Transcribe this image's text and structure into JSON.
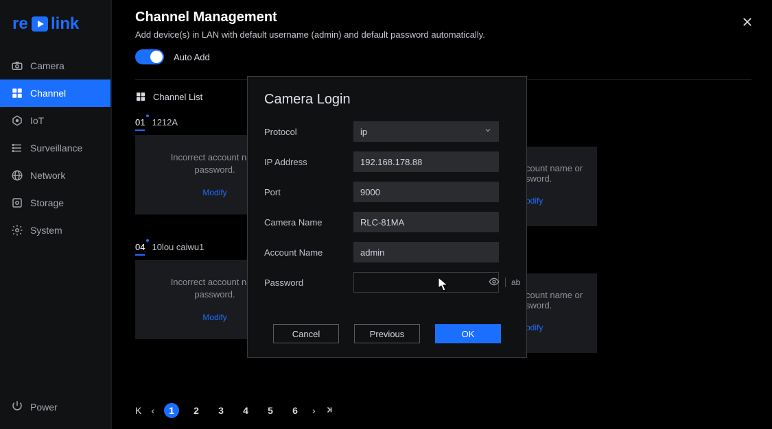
{
  "brand": {
    "name": "reolink"
  },
  "sidebar": {
    "items": [
      {
        "label": "Camera",
        "icon": "camera-icon"
      },
      {
        "label": "Channel",
        "icon": "channel-icon"
      },
      {
        "label": "IoT",
        "icon": "iot-icon"
      },
      {
        "label": "Surveillance",
        "icon": "surveillance-icon"
      },
      {
        "label": "Network",
        "icon": "network-icon"
      },
      {
        "label": "Storage",
        "icon": "storage-icon"
      },
      {
        "label": "System",
        "icon": "system-icon"
      }
    ],
    "active_index": 1,
    "power_label": "Power"
  },
  "header": {
    "title": "Channel Management",
    "subtitle": "Add device(s) in LAN with default username (admin) and default password automatically.",
    "auto_add_label": "Auto Add",
    "auto_add_on": true,
    "list_label": "Channel List"
  },
  "cards": {
    "row1": [
      {
        "num": "01",
        "name": "1212A",
        "msg_line1": "Incorrect account nam",
        "msg_line2": "password.",
        "action": "Modify"
      },
      {
        "num": "",
        "name": "",
        "msg_line1": "count name or",
        "msg_line2": "sword.",
        "action": "odify"
      }
    ],
    "row2": [
      {
        "num": "04",
        "name": "10lou caiwu1",
        "msg_line1": "Incorrect account nam",
        "msg_line2": "password.",
        "action": "Modify"
      },
      {
        "num": "",
        "name": "",
        "msg_line1": "count name or",
        "msg_line2": "sword.",
        "action": "odify"
      }
    ]
  },
  "pagination": {
    "first": "K",
    "prev": "‹",
    "pages": [
      "1",
      "2",
      "3",
      "4",
      "5",
      "6"
    ],
    "active_index": 0,
    "next": "›",
    "last": "⟩|"
  },
  "modal": {
    "title": "Camera Login",
    "fields": {
      "protocol_label": "Protocol",
      "protocol_value": "ip",
      "ip_label": "IP Address",
      "ip_value": "192.168.178.88",
      "port_label": "Port",
      "port_value": "9000",
      "name_label": "Camera Name",
      "name_value": "RLC-81MA",
      "account_label": "Account Name",
      "account_value": "admin",
      "password_label": "Password",
      "password_value": "",
      "password_kbd": "ab"
    },
    "buttons": {
      "cancel": "Cancel",
      "previous": "Previous",
      "ok": "OK"
    }
  },
  "colors": {
    "accent": "#1b6fff"
  }
}
